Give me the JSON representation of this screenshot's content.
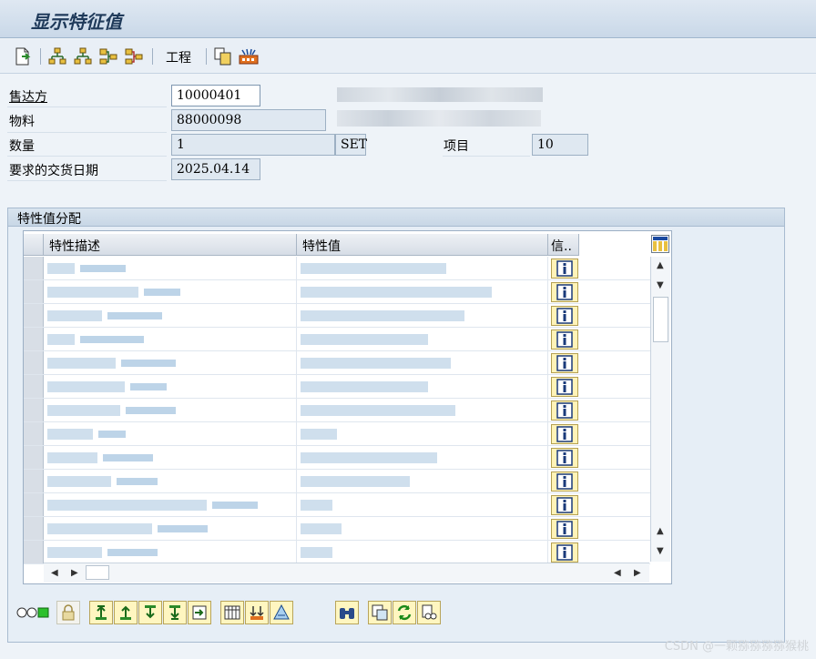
{
  "window": {
    "title": "显示特征值"
  },
  "toolbar": {
    "text_button": "工程"
  },
  "header": {
    "sold_to_label": "售达方",
    "sold_to_value": "10000401",
    "material_label": "物料",
    "material_value": "88000098",
    "quantity_label": "数量",
    "quantity_value": "1",
    "unit_value": "SET",
    "item_label": "项目",
    "item_value": "10",
    "delivery_date_label": "要求的交货日期",
    "delivery_date_value": "2025.04.14"
  },
  "group": {
    "title": "特性值分配"
  },
  "table": {
    "columns": [
      "特性描述",
      "特性值",
      "信.."
    ],
    "row_count": 13,
    "info_icon": "info-icon"
  },
  "watermark": "CSDN @一颗猕猕猕猕猴桃",
  "colors": {
    "accent": "#1f3a5a",
    "info_button": "#fff3b8"
  }
}
